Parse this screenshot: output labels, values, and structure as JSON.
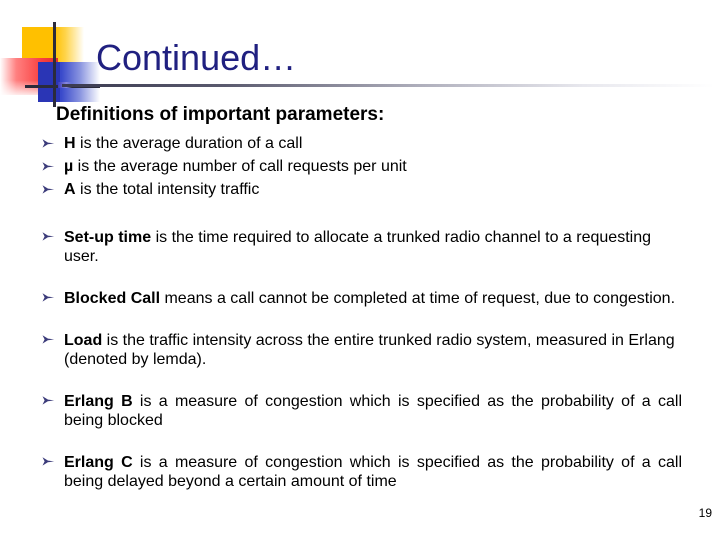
{
  "slide": {
    "title": "Continued…",
    "heading": "Definitions of important parameters:",
    "page_number": "19",
    "bullet_glyph": "arrow-bullet",
    "colors": {
      "title": "#202080",
      "bullet": "#3B3B7A",
      "body_text": "#000000",
      "deco_yellow": "#FFC000",
      "deco_red": "#F94040",
      "deco_blue": "#2A35B5",
      "deco_cross": "#2B2B3B",
      "background": "#FFFFFF"
    }
  },
  "group1": [
    {
      "term": "H",
      "rest": " is the average duration of a call"
    },
    {
      "term": "µ",
      "rest": " is the average number of call requests per unit"
    },
    {
      "term": "A",
      "rest": " is the total intensity traffic"
    }
  ],
  "group2": [
    {
      "term": "Set-up time",
      "rest": " is the time required to allocate a trunked radio channel to a requesting user.",
      "justified": false
    },
    {
      "term": "Blocked Call",
      "rest": " means a call cannot be completed at time of request, due to congestion.",
      "justified": false
    },
    {
      "term": "Load",
      "rest": " is the traffic intensity across the entire trunked radio system, measured in Erlang (denoted by lemda).",
      "justified": false
    },
    {
      "term": "Erlang B",
      "rest": " is a measure of congestion which is specified as the probability of a call being blocked",
      "justified": true
    },
    {
      "term": "Erlang C",
      "rest": " is a measure of congestion which is specified as the probability of a call being delayed beyond a certain amount of time",
      "justified": true
    }
  ]
}
